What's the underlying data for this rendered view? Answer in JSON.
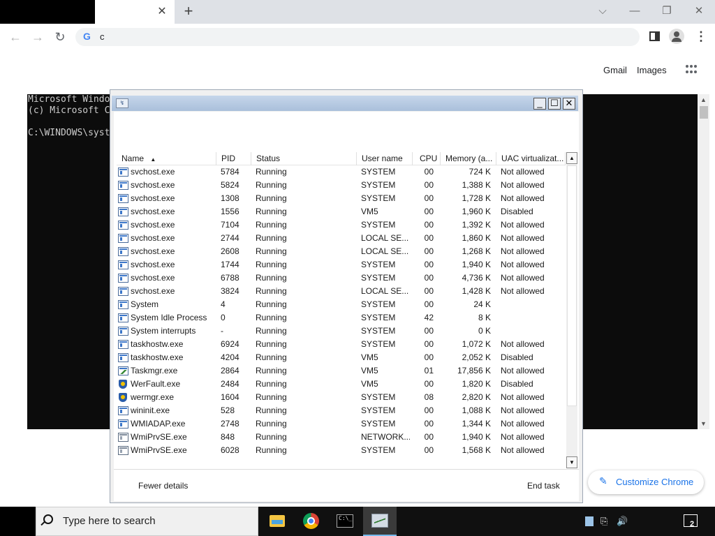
{
  "browser": {
    "omnibox_text": "c",
    "tab_close": "✕",
    "new_tab": "+",
    "controls": {
      "dropdown": "⌵",
      "minimize": "—",
      "restore": "❐",
      "close": "✕"
    },
    "nav": {
      "back": "←",
      "forward": "→",
      "reload": "↻",
      "menu": "⋮"
    }
  },
  "google": {
    "gmail": "Gmail",
    "images": "Images",
    "customize": "Customize Chrome",
    "customize_icon": "✎"
  },
  "console": {
    "lines": "Microsoft Windo\n(c) Microsoft C\n\nC:\\WINDOWS\\syst",
    "scroll_up": "▲",
    "scroll_down": "▼"
  },
  "task_manager": {
    "title_icon": "↯",
    "buttons": {
      "minimize": "_",
      "maximize": "☐",
      "close": "✕"
    },
    "columns": {
      "name": "Name",
      "pid": "PID",
      "status": "Status",
      "user": "User name",
      "cpu": "CPU",
      "memory": "Memory (a...",
      "uac": "UAC virtualizat..."
    },
    "sort_indicator": "▲",
    "rows": [
      {
        "name": "svchost.exe",
        "pid": "5784",
        "status": "Running",
        "user": "SYSTEM",
        "cpu": "00",
        "memory": "724 K",
        "uac": "Not allowed",
        "icon": "svc"
      },
      {
        "name": "svchost.exe",
        "pid": "5824",
        "status": "Running",
        "user": "SYSTEM",
        "cpu": "00",
        "memory": "1,388 K",
        "uac": "Not allowed",
        "icon": "svc"
      },
      {
        "name": "svchost.exe",
        "pid": "1308",
        "status": "Running",
        "user": "SYSTEM",
        "cpu": "00",
        "memory": "1,728 K",
        "uac": "Not allowed",
        "icon": "svc"
      },
      {
        "name": "svchost.exe",
        "pid": "1556",
        "status": "Running",
        "user": "VM5",
        "cpu": "00",
        "memory": "1,960 K",
        "uac": "Disabled",
        "icon": "svc"
      },
      {
        "name": "svchost.exe",
        "pid": "7104",
        "status": "Running",
        "user": "SYSTEM",
        "cpu": "00",
        "memory": "1,392 K",
        "uac": "Not allowed",
        "icon": "svc"
      },
      {
        "name": "svchost.exe",
        "pid": "2744",
        "status": "Running",
        "user": "LOCAL SE...",
        "cpu": "00",
        "memory": "1,860 K",
        "uac": "Not allowed",
        "icon": "svc"
      },
      {
        "name": "svchost.exe",
        "pid": "2608",
        "status": "Running",
        "user": "LOCAL SE...",
        "cpu": "00",
        "memory": "1,268 K",
        "uac": "Not allowed",
        "icon": "svc"
      },
      {
        "name": "svchost.exe",
        "pid": "1744",
        "status": "Running",
        "user": "SYSTEM",
        "cpu": "00",
        "memory": "1,940 K",
        "uac": "Not allowed",
        "icon": "svc"
      },
      {
        "name": "svchost.exe",
        "pid": "6788",
        "status": "Running",
        "user": "SYSTEM",
        "cpu": "00",
        "memory": "4,736 K",
        "uac": "Not allowed",
        "icon": "svc"
      },
      {
        "name": "svchost.exe",
        "pid": "3824",
        "status": "Running",
        "user": "LOCAL SE...",
        "cpu": "00",
        "memory": "1,428 K",
        "uac": "Not allowed",
        "icon": "svc"
      },
      {
        "name": "System",
        "pid": "4",
        "status": "Running",
        "user": "SYSTEM",
        "cpu": "00",
        "memory": "24 K",
        "uac": "",
        "icon": "svc"
      },
      {
        "name": "System Idle Process",
        "pid": "0",
        "status": "Running",
        "user": "SYSTEM",
        "cpu": "42",
        "memory": "8 K",
        "uac": "",
        "icon": "svc"
      },
      {
        "name": "System interrupts",
        "pid": "-",
        "status": "Running",
        "user": "SYSTEM",
        "cpu": "00",
        "memory": "0 K",
        "uac": "",
        "icon": "svc"
      },
      {
        "name": "taskhostw.exe",
        "pid": "6924",
        "status": "Running",
        "user": "SYSTEM",
        "cpu": "00",
        "memory": "1,072 K",
        "uac": "Not allowed",
        "icon": "svc"
      },
      {
        "name": "taskhostw.exe",
        "pid": "4204",
        "status": "Running",
        "user": "VM5",
        "cpu": "00",
        "memory": "2,052 K",
        "uac": "Disabled",
        "icon": "svc"
      },
      {
        "name": "Taskmgr.exe",
        "pid": "2864",
        "status": "Running",
        "user": "VM5",
        "cpu": "01",
        "memory": "17,856 K",
        "uac": "Not allowed",
        "icon": "graph"
      },
      {
        "name": "WerFault.exe",
        "pid": "2484",
        "status": "Running",
        "user": "VM5",
        "cpu": "00",
        "memory": "1,820 K",
        "uac": "Disabled",
        "icon": "shield"
      },
      {
        "name": "wermgr.exe",
        "pid": "1604",
        "status": "Running",
        "user": "SYSTEM",
        "cpu": "08",
        "memory": "2,820 K",
        "uac": "Not allowed",
        "icon": "shield"
      },
      {
        "name": "wininit.exe",
        "pid": "528",
        "status": "Running",
        "user": "SYSTEM",
        "cpu": "00",
        "memory": "1,088 K",
        "uac": "Not allowed",
        "icon": "svc"
      },
      {
        "name": "WMIADAP.exe",
        "pid": "2748",
        "status": "Running",
        "user": "SYSTEM",
        "cpu": "00",
        "memory": "1,344 K",
        "uac": "Not allowed",
        "icon": "svc"
      },
      {
        "name": "WmiPrvSE.exe",
        "pid": "848",
        "status": "Running",
        "user": "NETWORK...",
        "cpu": "00",
        "memory": "1,940 K",
        "uac": "Not allowed",
        "icon": "multi"
      },
      {
        "name": "WmiPrvSE.exe",
        "pid": "6028",
        "status": "Running",
        "user": "SYSTEM",
        "cpu": "00",
        "memory": "1,568 K",
        "uac": "Not allowed",
        "icon": "multi"
      }
    ],
    "fewer_details": "Fewer details",
    "end_task": "End task",
    "scroll_up": "▲",
    "scroll_down": "▼"
  },
  "taskbar": {
    "search_placeholder": "Type here to search",
    "cmd_glyph": "C:\\_",
    "tray_network": "⎘",
    "tray_volume": "🔊",
    "notification_count": "2"
  }
}
